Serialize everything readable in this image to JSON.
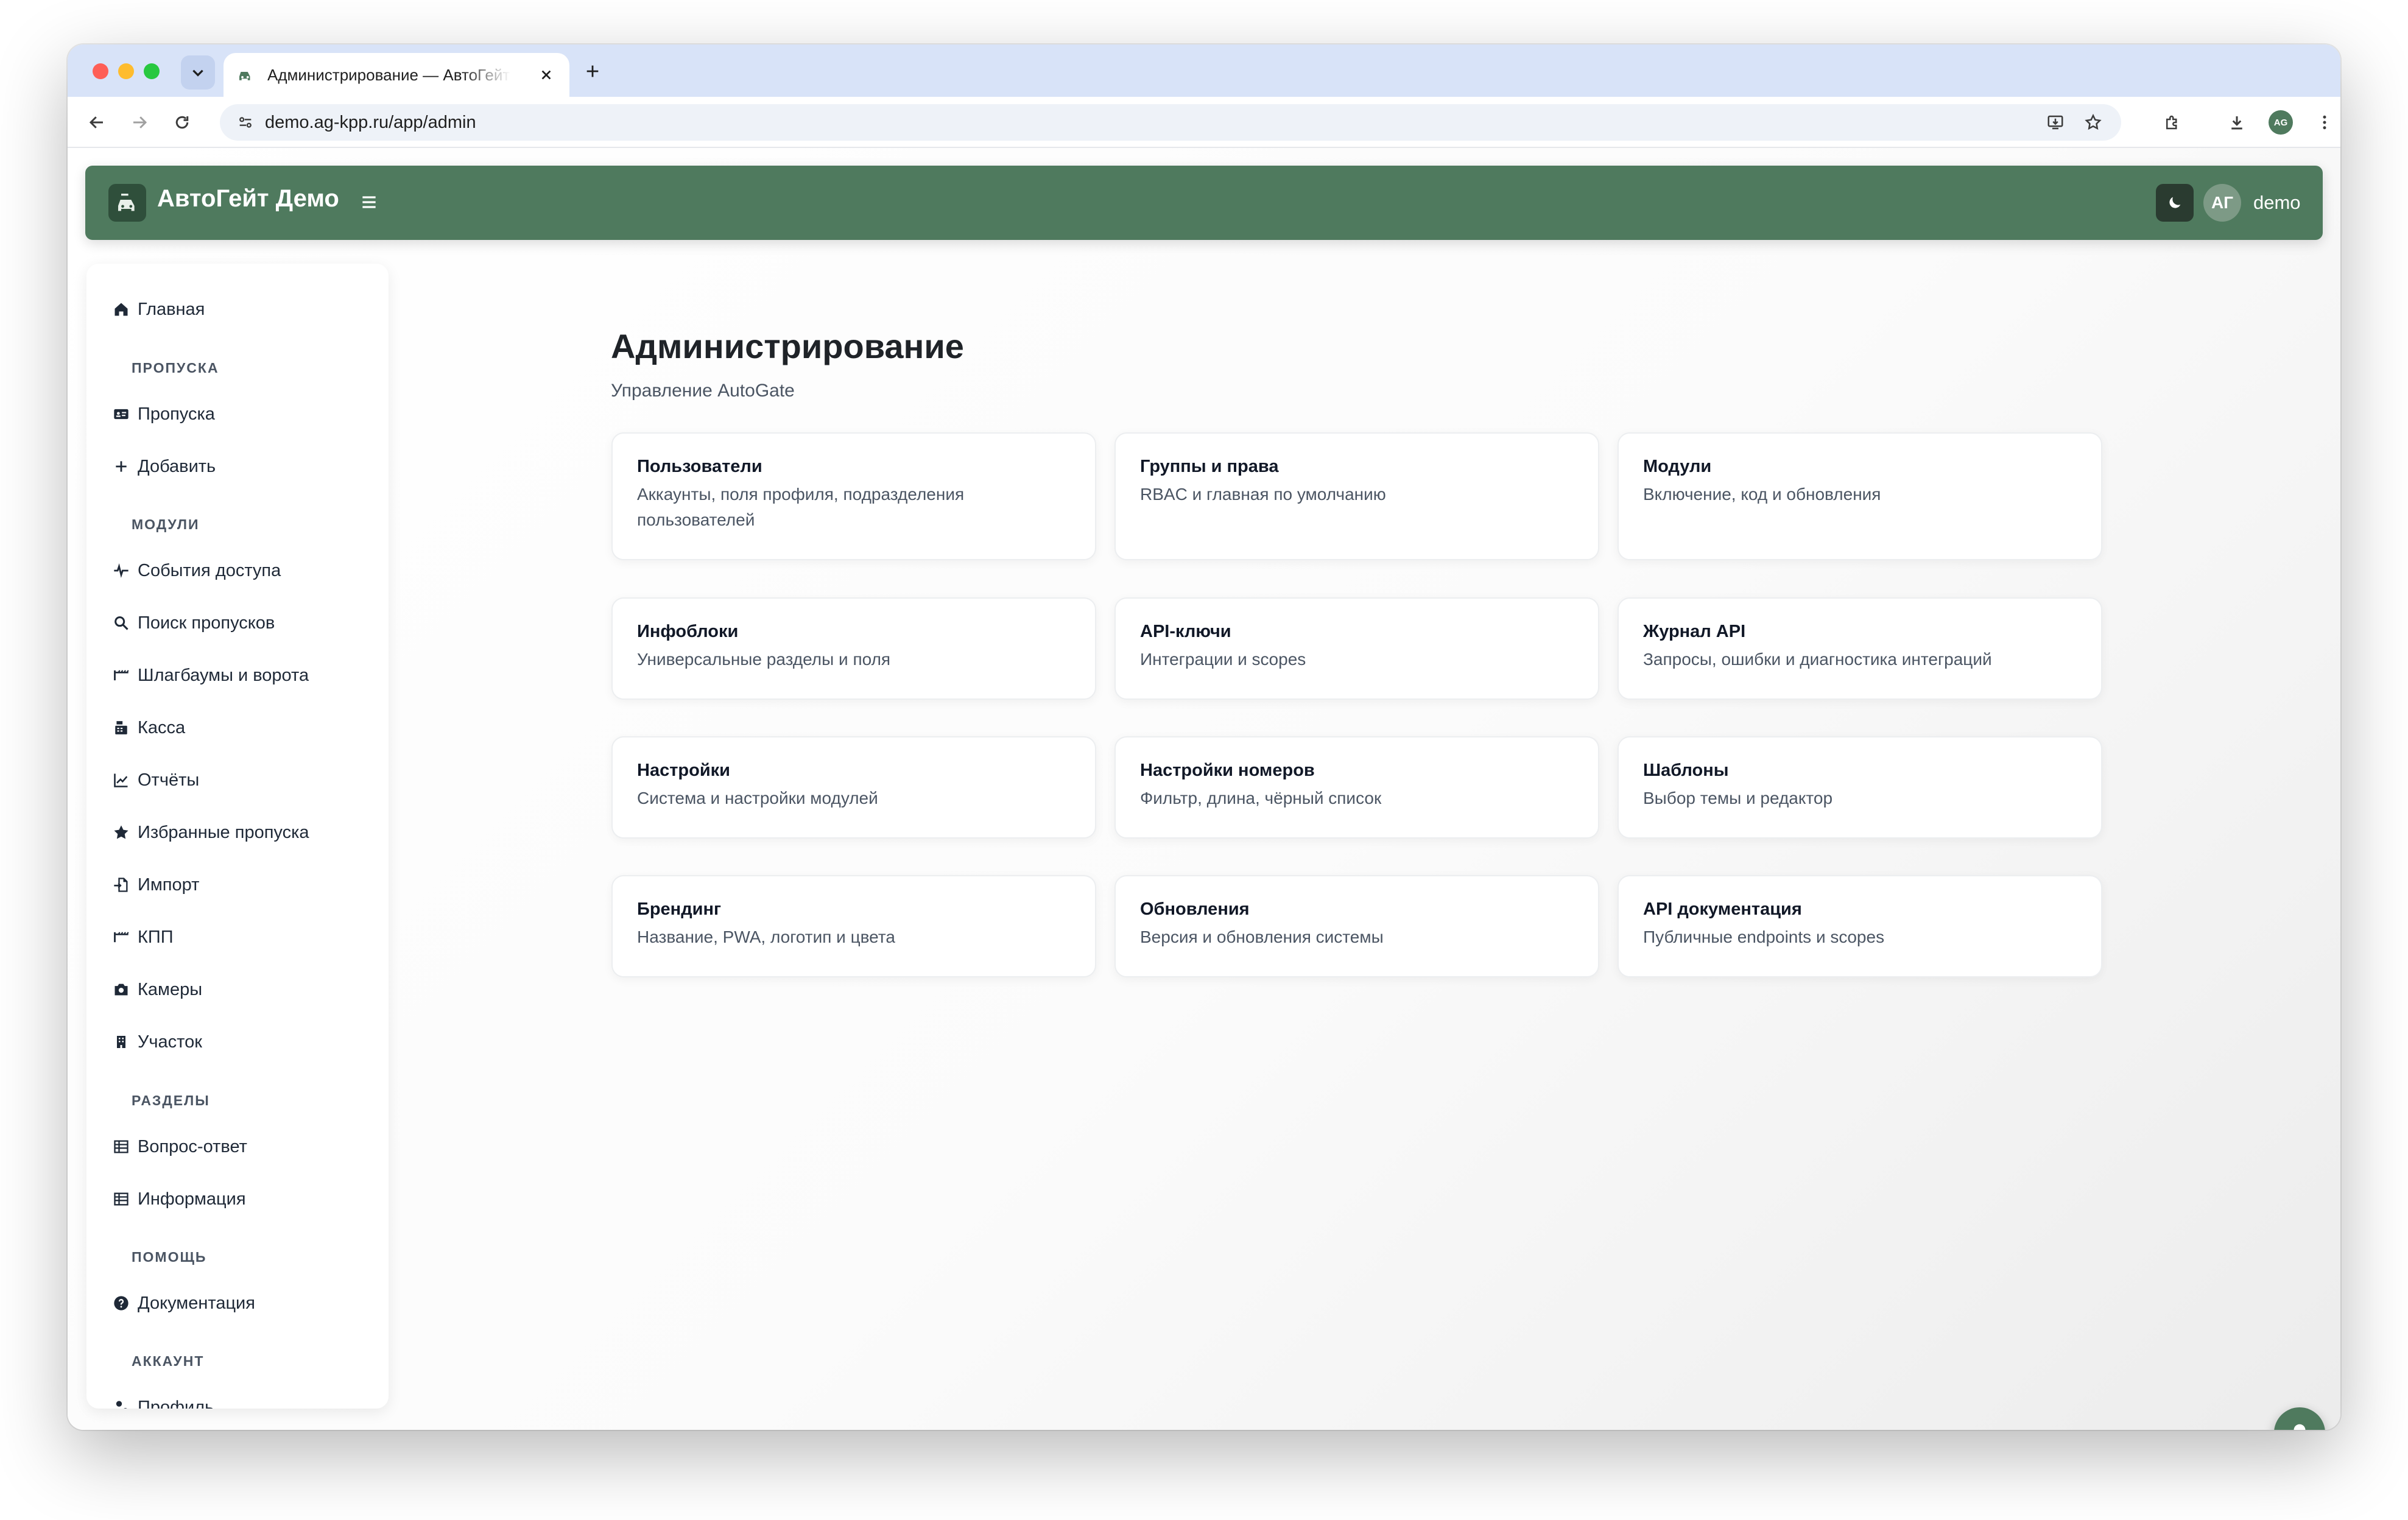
{
  "browser": {
    "tab_title": "Администрирование — АвтоГейт Демо",
    "url": "demo.ag-kpp.ru/app/admin",
    "profile_initials": "AG"
  },
  "appbar": {
    "title": "АвтоГейт Демо",
    "avatar_initials": "АГ",
    "username": "demo"
  },
  "sidebar": {
    "home": "Главная",
    "sections": {
      "passes": "ПРОПУСКА",
      "modules": "МОДУЛИ",
      "sections": "РАЗДЕЛЫ",
      "help": "ПОМОЩЬ",
      "account": "АККАУНТ"
    },
    "items": {
      "passes": "Пропуска",
      "add": "Добавить",
      "access_events": "События доступа",
      "pass_search": "Поиск пропусков",
      "barriers": "Шлагбаумы и ворота",
      "cashbox": "Касса",
      "reports": "Отчёты",
      "favorites": "Избранные пропуска",
      "import": "Импорт",
      "checkpoint": "КПП",
      "cameras": "Камеры",
      "area": "Участок",
      "faq": "Вопрос-ответ",
      "info": "Информация",
      "docs": "Документация",
      "profile": "Профиль"
    }
  },
  "main": {
    "title": "Администрирование",
    "subtitle": "Управление AutoGate",
    "cards": [
      {
        "title": "Пользователи",
        "desc": "Аккаунты, поля профиля, подразделения пользователей"
      },
      {
        "title": "Группы и права",
        "desc": "RBAC и главная по умолчанию"
      },
      {
        "title": "Модули",
        "desc": "Включение, код и обновления"
      },
      {
        "title": "Инфоблоки",
        "desc": "Универсальные разделы и поля"
      },
      {
        "title": "API-ключи",
        "desc": "Интеграции и scopes"
      },
      {
        "title": "Журнал API",
        "desc": "Запросы, ошибки и диагностика интеграций"
      },
      {
        "title": "Настройки",
        "desc": "Система и настройки модулей"
      },
      {
        "title": "Настройки номеров",
        "desc": "Фильтр, длина, чёрный список"
      },
      {
        "title": "Шаблоны",
        "desc": "Выбор темы и редактор"
      },
      {
        "title": "Брендинг",
        "desc": "Название, PWA, логотип и цвета"
      },
      {
        "title": "Обновления",
        "desc": "Версия и обновления системы"
      },
      {
        "title": "API документация",
        "desc": "Публичные endpoints и scopes"
      }
    ]
  },
  "colors": {
    "brand": "#4f7a5e",
    "brand_dark": "#2f4f3b",
    "tab_strip": "#d8e3f8"
  }
}
